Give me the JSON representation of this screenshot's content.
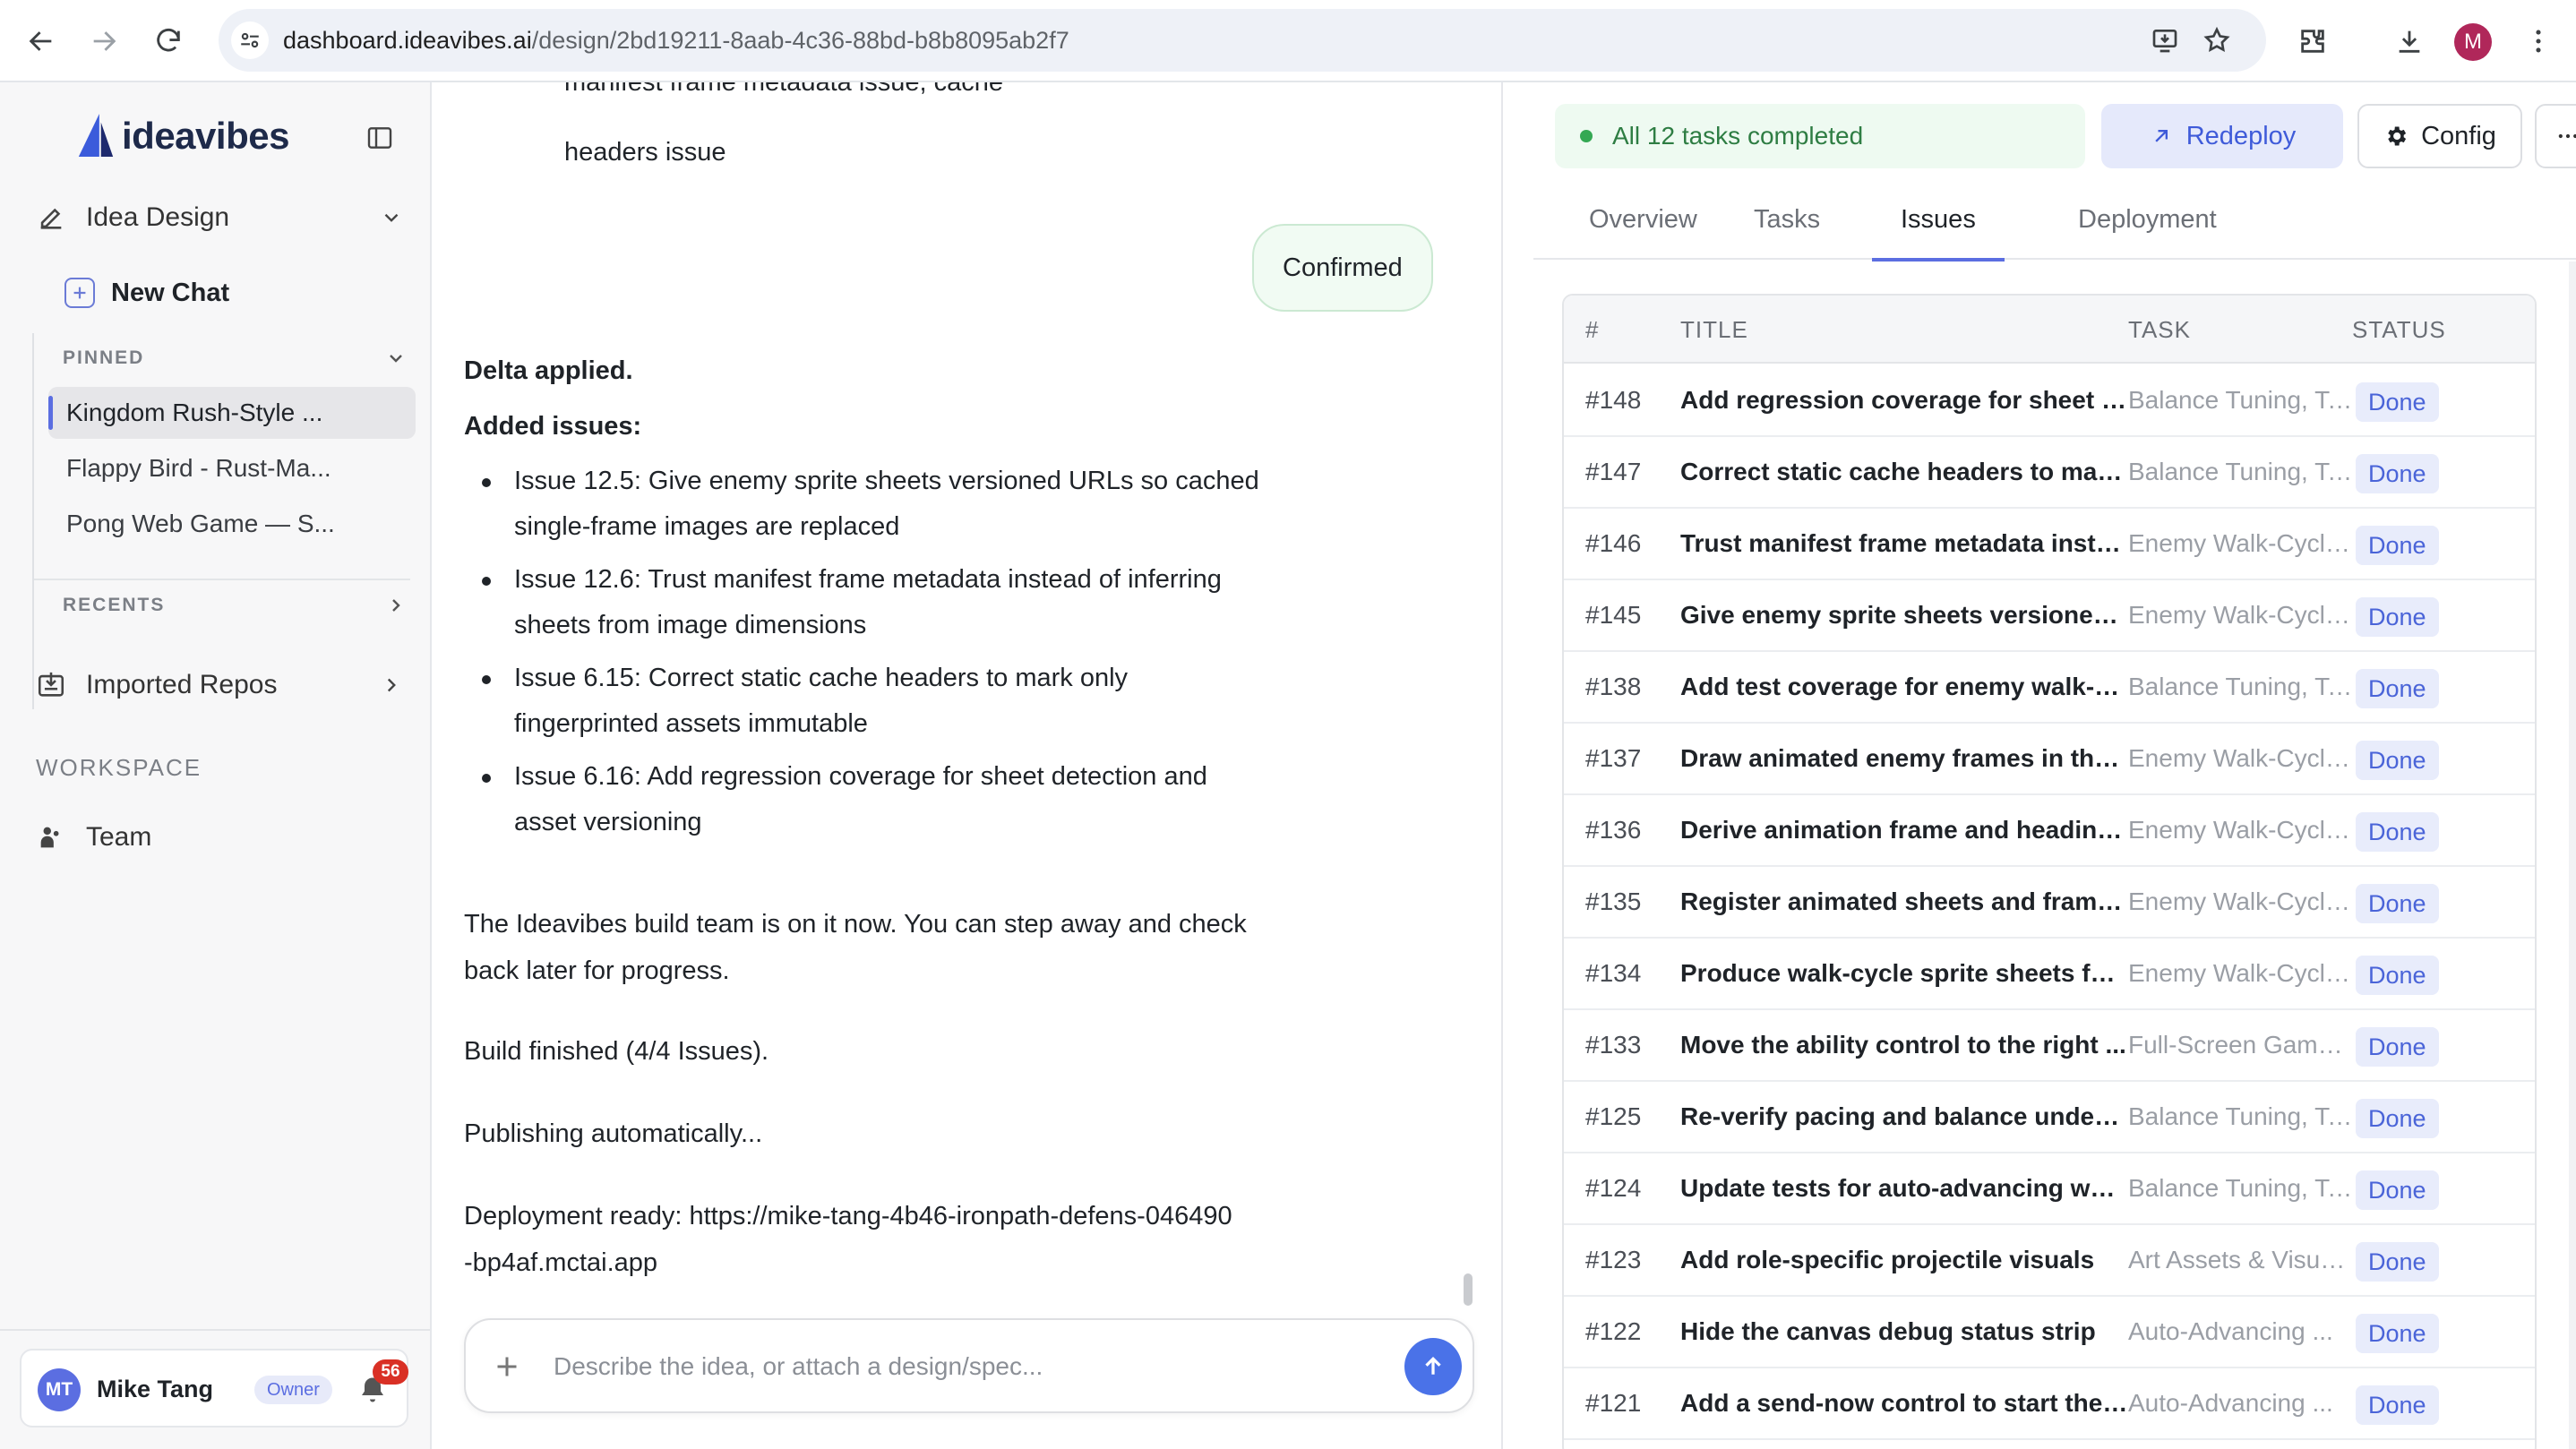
{
  "browser": {
    "url_host": "dashboard.ideavibes.ai",
    "url_path": "/design/2bd19211-8aab-4c36-88bd-b8b8095ab2f7",
    "profile_initial": "M"
  },
  "sidebar": {
    "brand": "ideavibes",
    "project_selector": "Idea Design",
    "new_chat": "New Chat",
    "pinned_label": "PINNED",
    "pinned": [
      "Kingdom Rush-Style ...",
      "Flappy Bird - Rust-Ma...",
      "Pong Web Game — S..."
    ],
    "recents_label": "RECENTS",
    "imported_repos": "Imported Repos",
    "workspace_label": "WORKSPACE",
    "team": "Team",
    "user": {
      "initials": "MT",
      "name": "Mike Tang",
      "role": "Owner",
      "notifications": "56"
    }
  },
  "chat": {
    "cut_off_line": "manifest frame metadata issue, cache",
    "cut_off_line2": "headers issue",
    "user_message": "Confirmed",
    "delta_applied": "Delta applied.",
    "added_issues_label": "Added issues:",
    "added_issues": [
      "Issue 12.5: Give enemy sprite sheets versioned URLs so cached single-frame images are replaced",
      "Issue 12.6: Trust manifest frame metadata instead of inferring sheets from image dimensions",
      "Issue 6.15: Correct static cache headers to mark only fingerprinted assets immutable",
      "Issue 6.16: Add regression coverage for sheet detection and asset versioning"
    ],
    "build_team_msg": "The Ideavibes build team is on it now. You can step away and check back later for progress.",
    "build_finished": "Build finished (4/4 Issues).",
    "publishing": "Publishing automatically...",
    "deployment_ready": "Deployment ready: https://mike-tang-4b46-ironpath-defens-046490-bp4af.mctai.app",
    "composer_placeholder": "Describe the idea, or attach a design/spec..."
  },
  "panel": {
    "status": "All 12 tasks completed",
    "redeploy": "Redeploy",
    "config": "Config",
    "tabs": [
      "Overview",
      "Tasks",
      "Issues",
      "Deployment"
    ],
    "active_tab": "Issues",
    "columns": [
      "#",
      "TITLE",
      "TASK",
      "STATUS"
    ],
    "rows": [
      {
        "num": "#148",
        "title": "Add regression coverage for sheet de...",
        "task": "Balance Tuning, Te...",
        "status": "Done"
      },
      {
        "num": "#147",
        "title": "Correct static cache headers to mark ...",
        "task": "Balance Tuning, Te...",
        "status": "Done"
      },
      {
        "num": "#146",
        "title": "Trust manifest frame metadata instea...",
        "task": "Enemy Walk-Cycle...",
        "status": "Done"
      },
      {
        "num": "#145",
        "title": "Give enemy sprite sheets versioned U...",
        "task": "Enemy Walk-Cycle...",
        "status": "Done"
      },
      {
        "num": "#138",
        "title": "Add test coverage for enemy walk-cy...",
        "task": "Balance Tuning, Te...",
        "status": "Done"
      },
      {
        "num": "#137",
        "title": "Draw animated enemy frames in the ...",
        "task": "Enemy Walk-Cycle...",
        "status": "Done"
      },
      {
        "num": "#136",
        "title": "Derive animation frame and heading ...",
        "task": "Enemy Walk-Cycle...",
        "status": "Done"
      },
      {
        "num": "#135",
        "title": "Register animated sheets and frame ...",
        "task": "Enemy Walk-Cycle...",
        "status": "Done"
      },
      {
        "num": "#134",
        "title": "Produce walk-cycle sprite sheets for t...",
        "task": "Enemy Walk-Cycle...",
        "status": "Done"
      },
      {
        "num": "#133",
        "title": "Move the ability control to the right ...",
        "task": "Full-Screen Game ...",
        "status": "Done"
      },
      {
        "num": "#125",
        "title": "Re-verify pacing and balance under a...",
        "task": "Balance Tuning, Te...",
        "status": "Done"
      },
      {
        "num": "#124",
        "title": "Update tests for auto-advancing wav...",
        "task": "Balance Tuning, Te...",
        "status": "Done"
      },
      {
        "num": "#123",
        "title": "Add role-specific projectile visuals",
        "task": "Art Assets & Visua...",
        "status": "Done"
      },
      {
        "num": "#122",
        "title": "Hide the canvas debug status strip",
        "task": "Auto-Advancing ...",
        "status": "Done"
      },
      {
        "num": "#121",
        "title": "Add a send-now control to start the ...",
        "task": "Auto-Advancing ...",
        "status": "Done"
      }
    ]
  },
  "colors": {
    "accent": "#5b6ee1",
    "success": "#34a853",
    "send_button": "#4a72e8"
  }
}
